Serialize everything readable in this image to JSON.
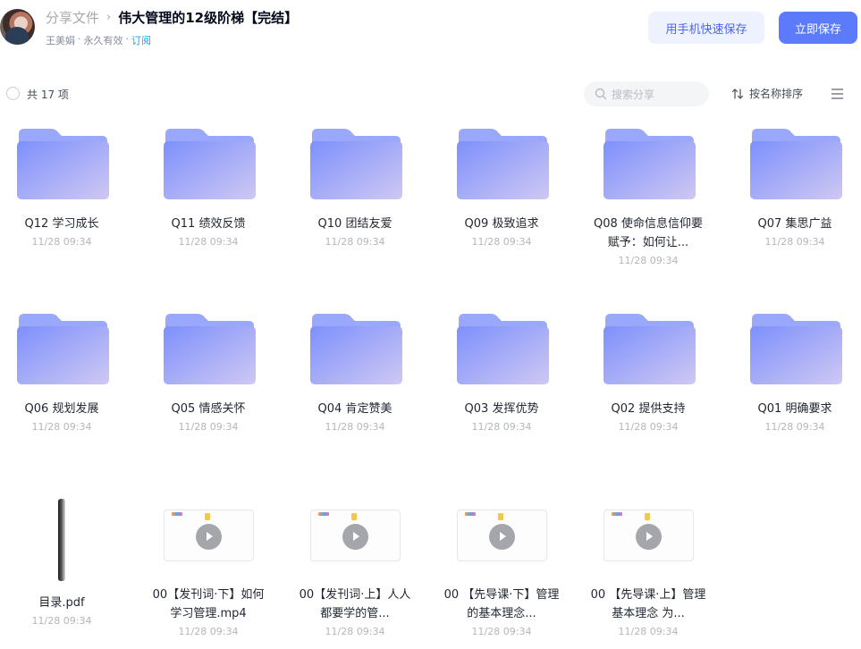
{
  "header": {
    "breadcrumb_root": "分享文件",
    "breadcrumb_sep": "›",
    "title": "伟大管理的12级阶梯【完结】",
    "owner": "王美娟",
    "dot1": "·",
    "validity": "永久有效",
    "dot2": "·",
    "subscribe": "订阅",
    "save_mobile": "用手机快速保存",
    "save_now": "立即保存"
  },
  "toolbar": {
    "count": "共 17 项",
    "search_placeholder": "搜索分享",
    "sort_label": "按名称排序"
  },
  "items": [
    {
      "kind": "folder",
      "name": "Q12 学习成长",
      "date": "11/28 09:34"
    },
    {
      "kind": "folder",
      "name": "Q11 绩效反馈",
      "date": "11/28 09:34"
    },
    {
      "kind": "folder",
      "name": "Q10 团结友爱",
      "date": "11/28 09:34"
    },
    {
      "kind": "folder",
      "name": "Q09 极致追求",
      "date": "11/28 09:34"
    },
    {
      "kind": "folder",
      "name": "Q08 使命信息信仰要赋予：如何让...",
      "date": "11/28 09:34"
    },
    {
      "kind": "folder",
      "name": "Q07 集思广益",
      "date": "11/28 09:34"
    },
    {
      "kind": "folder",
      "name": "Q06 规划发展",
      "date": "11/28 09:34"
    },
    {
      "kind": "folder",
      "name": "Q05 情感关怀",
      "date": "11/28 09:34"
    },
    {
      "kind": "folder",
      "name": "Q04 肯定赞美",
      "date": "11/28 09:34"
    },
    {
      "kind": "folder",
      "name": "Q03 发挥优势",
      "date": "11/28 09:34"
    },
    {
      "kind": "folder",
      "name": "Q02 提供支持",
      "date": "11/28 09:34"
    },
    {
      "kind": "folder",
      "name": "Q01 明确要求",
      "date": "11/28 09:34"
    },
    {
      "kind": "pdf",
      "name": "目录.pdf",
      "date": "11/28 09:34"
    },
    {
      "kind": "video",
      "name": "00【发刊词·下】如何学习管理.mp4",
      "date": "11/28 09:34"
    },
    {
      "kind": "video",
      "name": "00【发刊词·上】人人都要学的管...",
      "date": "11/28 09:34"
    },
    {
      "kind": "video",
      "name": "00 【先导课·下】管理的基本理念...",
      "date": "11/28 09:34"
    },
    {
      "kind": "video",
      "name": "00 【先导课·上】管理基本理念 为...",
      "date": "11/28 09:34"
    }
  ],
  "colors": {
    "accent": "#5c7bfb",
    "accent_light": "#eef2ff",
    "folder_top": "#8b9dfb",
    "folder_bottom": "#c8c4f3",
    "subscribe_link": "#06a7ff"
  },
  "icons": {
    "search": "search-icon",
    "sort": "sort-icon",
    "view_menu": "list-view-icon",
    "folder": "folder-icon",
    "video_play": "play-icon",
    "pdf": "pdf-file-icon"
  }
}
